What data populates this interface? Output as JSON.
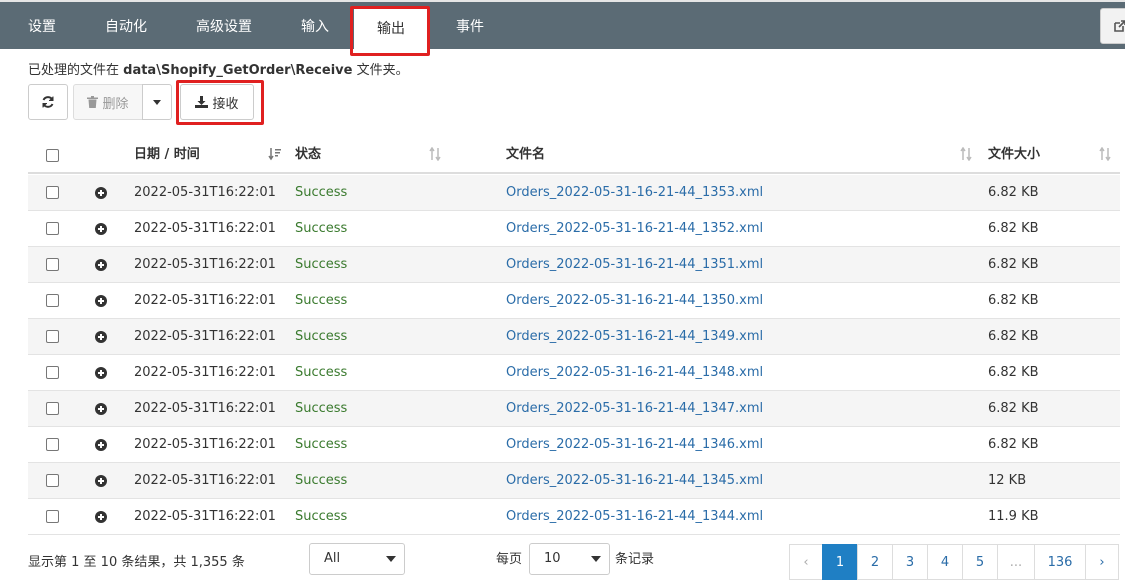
{
  "tabs": [
    {
      "label": "设置"
    },
    {
      "label": "自动化"
    },
    {
      "label": "高级设置"
    },
    {
      "label": "输入"
    },
    {
      "label": "输出"
    },
    {
      "label": "事件"
    }
  ],
  "info": {
    "prefix": "已处理的文件在 ",
    "path": "data\\Shopify_GetOrder\\Receive",
    "suffix": " 文件夹。"
  },
  "toolbar": {
    "delete_label": "删除",
    "receive_label": "接收"
  },
  "table": {
    "headers": {
      "datetime": "日期 / 时间",
      "status": "状态",
      "filename": "文件名",
      "filesize": "文件大小"
    },
    "rows": [
      {
        "datetime": "2022-05-31T16:22:01",
        "status": "Success",
        "filename": "Orders_2022-05-31-16-21-44_1353.xml",
        "size": "6.82 KB"
      },
      {
        "datetime": "2022-05-31T16:22:01",
        "status": "Success",
        "filename": "Orders_2022-05-31-16-21-44_1352.xml",
        "size": "6.82 KB"
      },
      {
        "datetime": "2022-05-31T16:22:01",
        "status": "Success",
        "filename": "Orders_2022-05-31-16-21-44_1351.xml",
        "size": "6.82 KB"
      },
      {
        "datetime": "2022-05-31T16:22:01",
        "status": "Success",
        "filename": "Orders_2022-05-31-16-21-44_1350.xml",
        "size": "6.82 KB"
      },
      {
        "datetime": "2022-05-31T16:22:01",
        "status": "Success",
        "filename": "Orders_2022-05-31-16-21-44_1349.xml",
        "size": "6.82 KB"
      },
      {
        "datetime": "2022-05-31T16:22:01",
        "status": "Success",
        "filename": "Orders_2022-05-31-16-21-44_1348.xml",
        "size": "6.82 KB"
      },
      {
        "datetime": "2022-05-31T16:22:01",
        "status": "Success",
        "filename": "Orders_2022-05-31-16-21-44_1347.xml",
        "size": "6.82 KB"
      },
      {
        "datetime": "2022-05-31T16:22:01",
        "status": "Success",
        "filename": "Orders_2022-05-31-16-21-44_1346.xml",
        "size": "6.82 KB"
      },
      {
        "datetime": "2022-05-31T16:22:01",
        "status": "Success",
        "filename": "Orders_2022-05-31-16-21-44_1345.xml",
        "size": "12 KB"
      },
      {
        "datetime": "2022-05-31T16:22:01",
        "status": "Success",
        "filename": "Orders_2022-05-31-16-21-44_1344.xml",
        "size": "11.9 KB"
      }
    ]
  },
  "footer": {
    "summary": "显示第 1 至 10 条结果，共 1,355 条",
    "filter_value": "All",
    "per_page_prefix": "每页",
    "per_page_value": "10",
    "per_page_suffix": "条记录"
  },
  "pagination": {
    "prev": "‹",
    "pages": [
      "1",
      "2",
      "3",
      "4",
      "5",
      "...",
      "136"
    ],
    "next": "›",
    "current": "1"
  },
  "icons": {
    "refresh": "refresh-icon",
    "trash": "trash-icon",
    "download": "download-icon",
    "external": "external-link-icon"
  },
  "colors": {
    "topbar": "#5b6b75",
    "highlight": "#e02020",
    "status_success": "#3a7a2e",
    "link": "#2a6ca8",
    "pager_active": "#1f7fc4"
  }
}
